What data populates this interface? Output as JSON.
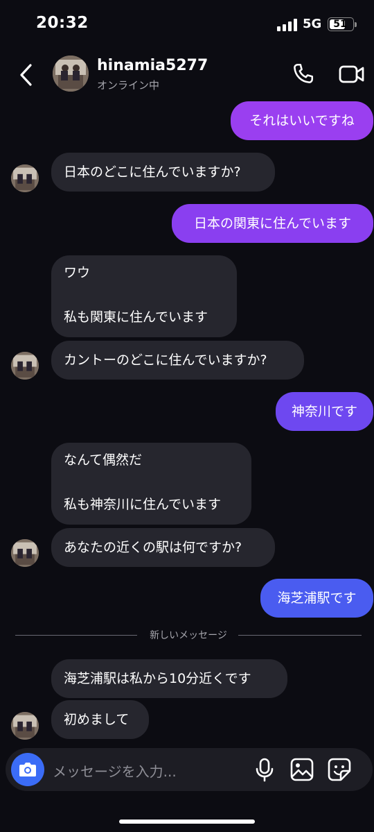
{
  "status_bar": {
    "time": "20:32",
    "network": "5G",
    "battery": "51"
  },
  "header": {
    "username": "hinamia5277",
    "status": "オンライン中"
  },
  "messages": [
    {
      "side": "out",
      "text": "それはいいですね"
    },
    {
      "side": "in",
      "text": "日本のどこに住んでいますか?"
    },
    {
      "side": "out",
      "text": "日本の関東に住んでいます"
    },
    {
      "side": "in",
      "line1": "ワウ",
      "line2": "私も関東に住んでいます"
    },
    {
      "side": "in",
      "text": "カントーのどこに住んでいますか?"
    },
    {
      "side": "out",
      "text": "神奈川です"
    },
    {
      "side": "in",
      "line1": "なんて偶然だ",
      "line2": "私も神奈川に住んでいます"
    },
    {
      "side": "in",
      "text": "あなたの近くの駅は何ですか?"
    },
    {
      "side": "out",
      "text": "海芝浦駅です"
    },
    {
      "side": "in",
      "text": "海芝浦駅は私から10分近くです"
    },
    {
      "side": "in",
      "text": "初めまして"
    }
  ],
  "divider_label": "新しいメッセージ",
  "composer": {
    "placeholder": "メッセージを入力..."
  },
  "colors": {
    "bubble_in": "#26262e",
    "bubble_out_top": "#a23fe8",
    "bubble_out_bottom": "#4a5cf0",
    "camera_button": "#3b6cf6"
  },
  "icons": [
    "back-icon",
    "phone-icon",
    "video-icon",
    "camera-icon",
    "mic-icon",
    "gallery-icon",
    "sticker-icon"
  ]
}
